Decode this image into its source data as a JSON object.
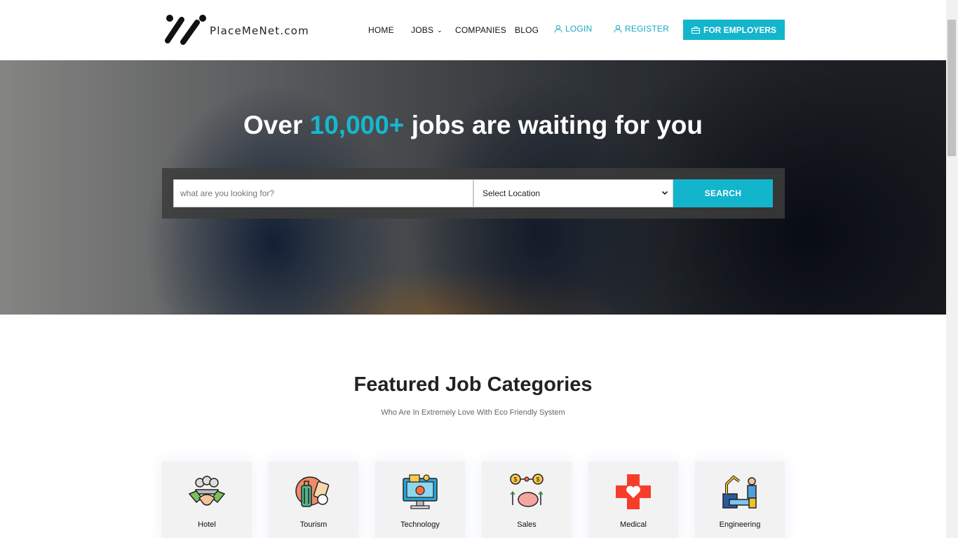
{
  "brand": {
    "name": "PlaceMeNet.com"
  },
  "nav": {
    "home": "HOME",
    "jobs": "JOBS",
    "companies": "COMPANIES",
    "blog": "BLOG",
    "login": "LOGIN",
    "register": "REGISTER",
    "employers": "FOR EMPLOYERS"
  },
  "hero": {
    "title_pre": "Over",
    "title_accent": "10,000+",
    "title_post": "jobs are waiting for you",
    "search_placeholder": "what are you looking for?",
    "location_selected": "Select Location",
    "search_button": "SEARCH"
  },
  "featured": {
    "title": "Featured Job Categories",
    "subtitle": "Who Are In Extremely Love With Eco Friendly System",
    "categories": [
      {
        "label": "Hotel",
        "icon": "handshake-icon"
      },
      {
        "label": "Tourism",
        "icon": "luggage-icon"
      },
      {
        "label": "Technology",
        "icon": "computer-icon"
      },
      {
        "label": "Sales",
        "icon": "piggy-bank-icon"
      },
      {
        "label": "Medical",
        "icon": "medical-cross-icon"
      },
      {
        "label": "Engineering",
        "icon": "engineer-robot-arm-icon"
      }
    ]
  },
  "colors": {
    "accent": "#13b5cc",
    "text": "#222222"
  }
}
